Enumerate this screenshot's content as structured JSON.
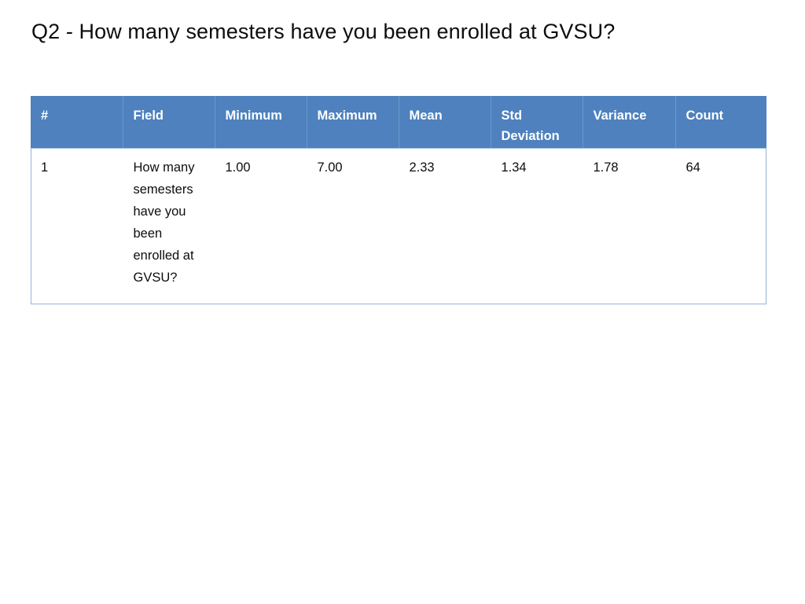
{
  "slide": {
    "title": "Q2 - How many semesters have you been enrolled at GVSU?"
  },
  "colors": {
    "header_fill": "#4E81BD",
    "header_divider": "#6E99CC",
    "body_border": "#95B3D7",
    "text": "#0D0D0D",
    "header_text": "#FFFFFF",
    "background": "#FFFFFF"
  },
  "table": {
    "headers": [
      "#",
      "Field",
      "Minimum",
      "Maximum",
      "Mean",
      "Std Deviation",
      "Variance",
      "Count"
    ],
    "rows": [
      {
        "num": "1",
        "field": "How many semesters have you been enrolled at GVSU?",
        "minimum": "1.00",
        "maximum": "7.00",
        "mean": "2.33",
        "std_deviation": "1.34",
        "variance": "1.78",
        "count": "64"
      }
    ]
  },
  "chart_data": {
    "type": "table",
    "title": "Q2 - How many semesters have you been enrolled at GVSU?",
    "columns": [
      "#",
      "Field",
      "Minimum",
      "Maximum",
      "Mean",
      "Std Deviation",
      "Variance",
      "Count"
    ],
    "rows": [
      [
        "1",
        "How many semesters have you been enrolled at GVSU?",
        "1.00",
        "7.00",
        "2.33",
        "1.34",
        "1.78",
        "64"
      ]
    ],
    "statistics": {
      "minimum": 1.0,
      "maximum": 7.0,
      "mean": 2.33,
      "std_deviation": 1.34,
      "variance": 1.78,
      "count": 64
    }
  }
}
